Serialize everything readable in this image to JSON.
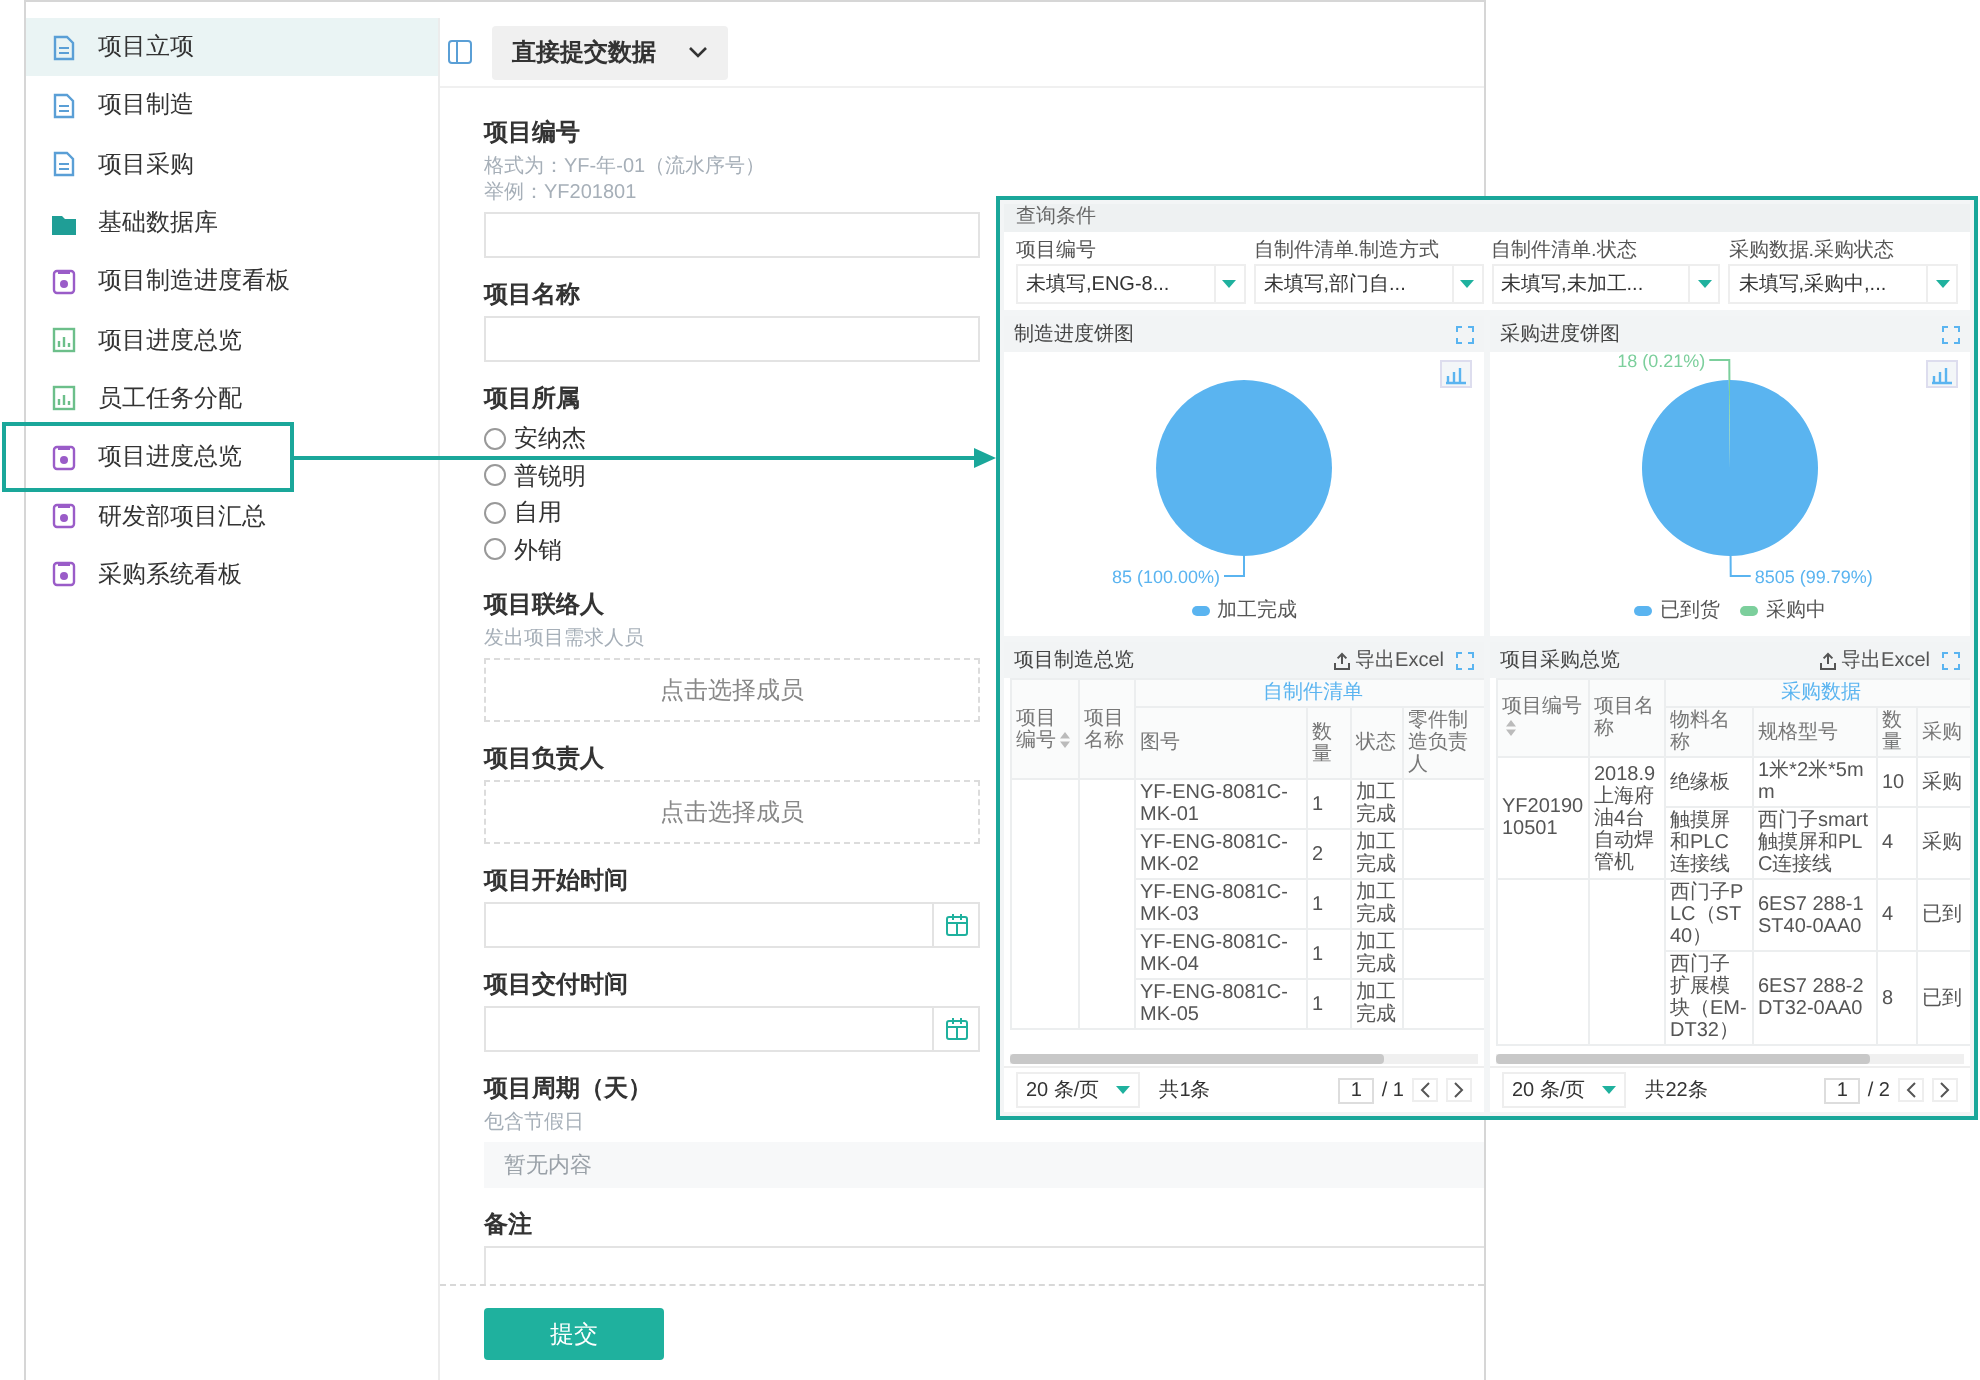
{
  "sidebar": {
    "items": [
      {
        "label": "项目立项",
        "kind": "doc",
        "selected": true,
        "callout": false
      },
      {
        "label": "项目制造",
        "kind": "doc",
        "selected": false,
        "callout": false
      },
      {
        "label": "项目采购",
        "kind": "doc",
        "selected": false,
        "callout": false
      },
      {
        "label": "基础数据库",
        "kind": "folder",
        "selected": false,
        "callout": false
      },
      {
        "label": "项目制造进度看板",
        "kind": "form",
        "selected": false,
        "callout": false
      },
      {
        "label": "项目进度总览",
        "kind": "chart",
        "selected": false,
        "callout": false
      },
      {
        "label": "员工任务分配",
        "kind": "chart",
        "selected": false,
        "callout": false
      },
      {
        "label": "项目进度总览",
        "kind": "form",
        "selected": false,
        "callout": true
      },
      {
        "label": "研发部项目汇总",
        "kind": "form",
        "selected": false,
        "callout": false
      },
      {
        "label": "采购系统看板",
        "kind": "form",
        "selected": false,
        "callout": false
      }
    ]
  },
  "toolbar": {
    "mode_button": "直接提交数据"
  },
  "form": {
    "fields": [
      {
        "kind": "text",
        "label": "项目编号",
        "hints": [
          "格式为：YF-年-01（流水序号）",
          "举例：YF201801"
        ]
      },
      {
        "kind": "text",
        "label": "项目名称"
      },
      {
        "kind": "radio",
        "label": "项目所属",
        "options": [
          {
            "label": "安纳杰",
            "selected": false
          },
          {
            "label": "普锐明",
            "selected": false
          },
          {
            "label": "自用",
            "selected": false
          },
          {
            "label": "外销",
            "selected": false
          }
        ]
      },
      {
        "kind": "member",
        "label": "项目联络人",
        "hints": [
          "发出项目需求人员"
        ],
        "button": "点击选择成员"
      },
      {
        "kind": "member",
        "label": "项目负责人",
        "button": "点击选择成员"
      },
      {
        "kind": "date",
        "label": "项目开始时间"
      },
      {
        "kind": "date",
        "label": "项目交付时间"
      },
      {
        "kind": "readonly",
        "label": "项目周期（天）",
        "hints": [
          "包含节假日"
        ],
        "placeholder": "暂无内容"
      },
      {
        "kind": "textarea",
        "label": "备注"
      }
    ],
    "submit": "提交"
  },
  "dashboard": {
    "filters": {
      "title": "查询条件",
      "items": [
        {
          "label": "项目编号",
          "value": "未填写,ENG-8..."
        },
        {
          "label": "自制件清单.制造方式",
          "value": "未填写,部门自..."
        },
        {
          "label": "自制件清单.状态",
          "value": "未填写,未加工..."
        },
        {
          "label": "采购数据.采购状态",
          "value": "未填写,采购中,..."
        }
      ]
    },
    "pies": [
      {
        "chart_data": {
          "type": "pie",
          "title": "制造进度饼图",
          "categories": [
            "加工完成"
          ],
          "values": [
            85
          ],
          "colors": [
            "#5ab4f0"
          ],
          "value_labels": [
            "85 (100.00%)"
          ]
        }
      },
      {
        "chart_data": {
          "type": "pie",
          "title": "采购进度饼图",
          "categories": [
            "已到货",
            "采购中"
          ],
          "values": [
            8505,
            18
          ],
          "colors": [
            "#5ab4f0",
            "#7ccf9c"
          ],
          "value_labels": [
            "8505 (99.79%)",
            "18 (0.21%)"
          ]
        }
      }
    ],
    "tables": [
      {
        "title": "项目制造总览",
        "export": "导出Excel",
        "lead_columns": [
          "项目编号",
          "项目名称"
        ],
        "group_header": "自制件清单",
        "columns": [
          "图号",
          "数量",
          "状态",
          "零件制造负责人"
        ],
        "groups": [
          {
            "rows": [
              [
                "YF-ENG-8081C-MK-01",
                "1",
                "加工完成"
              ],
              [
                "YF-ENG-8081C-MK-02",
                "2",
                "加工完成"
              ],
              [
                "YF-ENG-8081C-MK-03",
                "1",
                "加工完成"
              ],
              [
                "YF-ENG-8081C-MK-04",
                "1",
                "加工完成"
              ],
              [
                "YF-ENG-8081C-MK-05",
                "1",
                "加工完成"
              ]
            ]
          }
        ],
        "page_size": "20 条/页",
        "total": "共1条",
        "page": "1",
        "pages": "/ 1"
      },
      {
        "title": "项目采购总览",
        "export": "导出Excel",
        "lead_columns": [
          "项目编号",
          "项目名称"
        ],
        "group_header": "采购数据",
        "columns": [
          "物料名称",
          "规格型号",
          "数量",
          "采购"
        ],
        "groups": [
          {
            "id": "YF2019010501",
            "name": "2018.9上海府油4台自动焊管机",
            "rows": [
              [
                "绝缘板",
                "1米*2米*5mm",
                "10",
                "采购"
              ],
              [
                "触摸屏和PLC连接线",
                "西门子smart触摸屏和PLC连接线",
                "4",
                "采购"
              ]
            ]
          },
          {
            "rows": [
              [
                "西门子PLC（ST40）",
                "6ES7 288-1ST40-0AA0",
                "4",
                "已到"
              ],
              [
                "西门子扩展模块（EM-DT32）",
                "6ES7 288-2DT32-0AA0",
                "8",
                "已到"
              ]
            ]
          }
        ],
        "page_size": "20 条/页",
        "total": "共22条",
        "page": "1",
        "pages": "/ 2"
      }
    ]
  }
}
